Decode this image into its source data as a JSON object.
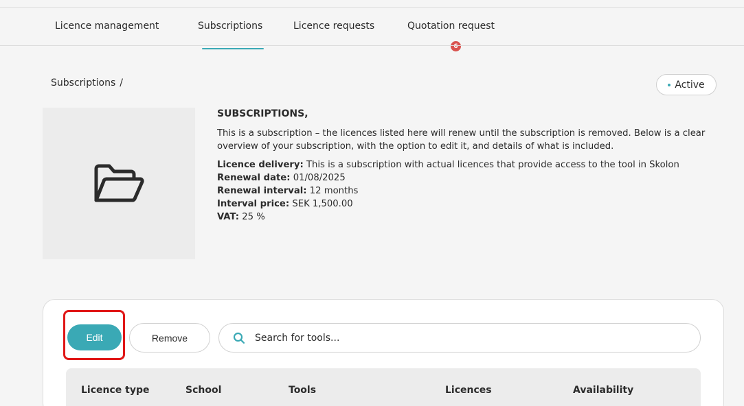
{
  "tabs": [
    {
      "label": "Licence management"
    },
    {
      "label": "Subscriptions"
    },
    {
      "label": "Licence requests"
    },
    {
      "label": "Quotation request",
      "badge": "6"
    }
  ],
  "active_tab": "Subscriptions",
  "breadcrumb": {
    "label": "Subscriptions",
    "separator": "/"
  },
  "status": {
    "label": "Active"
  },
  "details": {
    "heading": "SUBSCRIPTIONS,",
    "description": "This is a subscription – the licences listed here will renew until the subscription is removed. Below is a clear overview of your subscription, with the option to edit it, and details of what is included.",
    "delivery_label": "Licence delivery:",
    "delivery_value": "This is a subscription with actual licences that provide access to the tool in Skolon",
    "renewal_date_label": "Renewal date:",
    "renewal_date_value": "01/08/2025",
    "renewal_interval_label": "Renewal interval:",
    "renewal_interval_value": "12 months",
    "interval_price_label": "Interval price:",
    "interval_price_value": "SEK 1,500.00",
    "vat_label": "VAT:",
    "vat_value": "25 %"
  },
  "actions": {
    "edit": "Edit",
    "remove": "Remove"
  },
  "search": {
    "placeholder": "Search for tools..."
  },
  "table": {
    "columns": [
      "Licence type",
      "School",
      "Tools",
      "Licences",
      "Availability"
    ]
  },
  "colors": {
    "accent": "#3aa9b5",
    "badge": "#d9534f",
    "highlight": "#e01717"
  },
  "icons": {
    "thumbnail": "folder-open-icon",
    "search": "search-icon"
  }
}
